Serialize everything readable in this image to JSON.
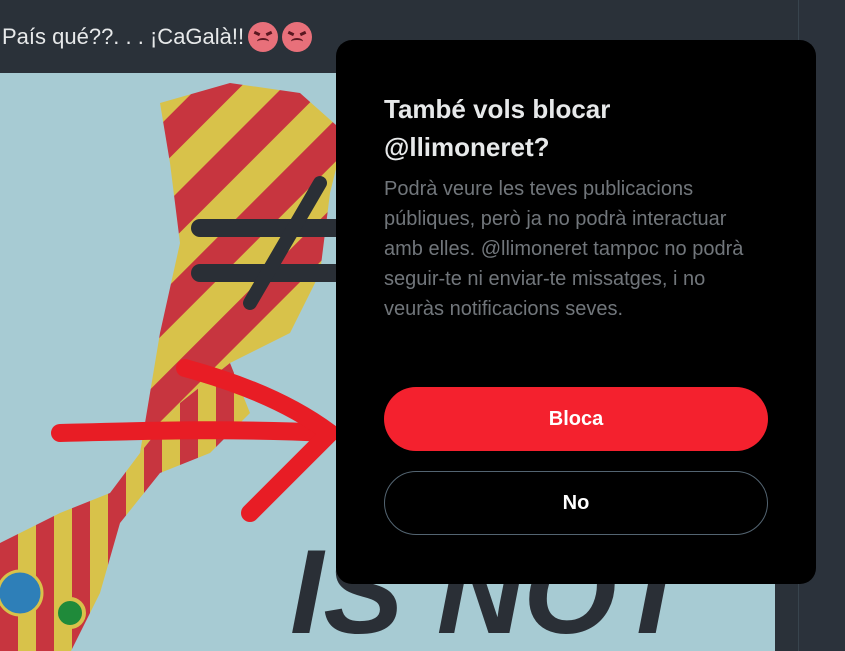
{
  "tweet": {
    "text": "País qué??. . . ¡CaGalà!!",
    "emoji_icons": [
      "angry-face-icon",
      "angry-face-icon"
    ]
  },
  "media": {
    "overlay_text": "IS NOT"
  },
  "dialog": {
    "title": "També vols blocar @llimoneret?",
    "body": "Podrà veure les teves publicacions públiques, però ja no podrà interactuar amb elles. @llimoneret tampoc no podrà seguir-te ni enviar-te missatges, i no veuràs notificacions seves.",
    "confirm_label": "Bloca",
    "cancel_label": "No"
  },
  "colors": {
    "confirm": "#f4212e",
    "dialog_bg": "#000000",
    "page_bg": "#15202b"
  }
}
